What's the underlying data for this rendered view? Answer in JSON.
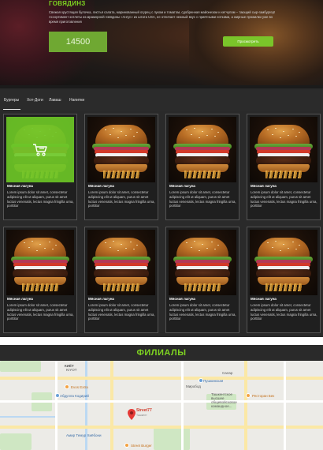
{
  "hero": {
    "title": "ГОВЯДИНЗ",
    "description": "Свежая хрустящая булочка, листья салата, маринованный огурец с луком и томатом, сдобренная майонезом и кетчупом – тающий сыр-гамбургер! Ассортимент котлеты из мраморной говядины «Ангус» из штата USA, ее отличает нежный вкус с приятными нотками, а жирные прожилки уже во время приготовления",
    "price": "14500",
    "order_label": "Просмотреть"
  },
  "tabs": [
    {
      "label": "Бургеры"
    },
    {
      "label": "Хот-Доги"
    },
    {
      "label": "Лаваш"
    },
    {
      "label": "Напитки"
    }
  ],
  "products": [
    {
      "title": "Мясная лагуна",
      "text": "Lorem ipsum dolor sit amet, consectetur adipiscing elit ut aliquam, purus sit amet luctus venenatis, lectus magna fringilla urna, porttitor"
    },
    {
      "title": "Мясная лагуна",
      "text": "Lorem ipsum dolor sit amet, consectetur adipiscing elit ut aliquam, purus sit amet luctus venenatis, lectus magna fringilla urna, porttitor"
    },
    {
      "title": "Мясная лагуна",
      "text": "Lorem ipsum dolor sit amet, consectetur adipiscing elit ut aliquam, purus sit amet luctus venenatis, lectus magna fringilla urna, porttitor"
    },
    {
      "title": "Мясная лагуна",
      "text": "Lorem ipsum dolor sit amet, consectetur adipiscing elit ut aliquam, purus sit amet luctus venenatis, lectus magna fringilla urna, porttitor"
    },
    {
      "title": "Мясная лагуна",
      "text": "Lorem ipsum dolor sit amet, consectetur adipiscing elit ut aliquam, purus sit amet luctus venenatis, lectus magna fringilla urna, porttitor"
    },
    {
      "title": "Мясная лагуна",
      "text": "Lorem ipsum dolor sit amet, consectetur adipiscing elit ut aliquam, purus sit amet luctus venenatis, lectus magna fringilla urna, porttitor"
    },
    {
      "title": "Мясная лагуна",
      "text": "Lorem ipsum dolor sit amet, consectetur adipiscing elit ut aliquam, purus sit amet luctus venenatis, lectus magna fringilla urna, porttitor"
    },
    {
      "title": "Мясная лагуна",
      "text": "Lorem ipsum dolor sit amet, consectetur adipiscing elit ut aliquam, purus sit amet luctus venenatis, lectus magna fringilla urna, porttitor"
    }
  ],
  "branches": {
    "title": "ФИЛИАЛЫ"
  },
  "map": {
    "labels": {
      "kiyet": "КИЁТ",
      "kiyot": "KIYOT",
      "evos": "Evos Extra",
      "abdulla": "Абдулла Кодирий",
      "street": "Street77",
      "street_sub": "Ташкент",
      "amir": "Амир Темур Хиёбони",
      "burger": "Street Burger",
      "salar": "Салар",
      "mirabad": "Миробод",
      "shkola": "Ташкентское высшее общевойсковое командное...",
      "restoran": "Ресторан Бек",
      "pushkin": "Пушкинская"
    }
  },
  "colors": {
    "accent": "#7ed321",
    "price_bg": "#6fa832",
    "overlay": "#6ec828",
    "card_bg": "#1f1f1f",
    "page_bg": "#2a2a2a"
  },
  "icons": {
    "cart": "cart-icon",
    "map_pin": "map-pin-icon"
  }
}
